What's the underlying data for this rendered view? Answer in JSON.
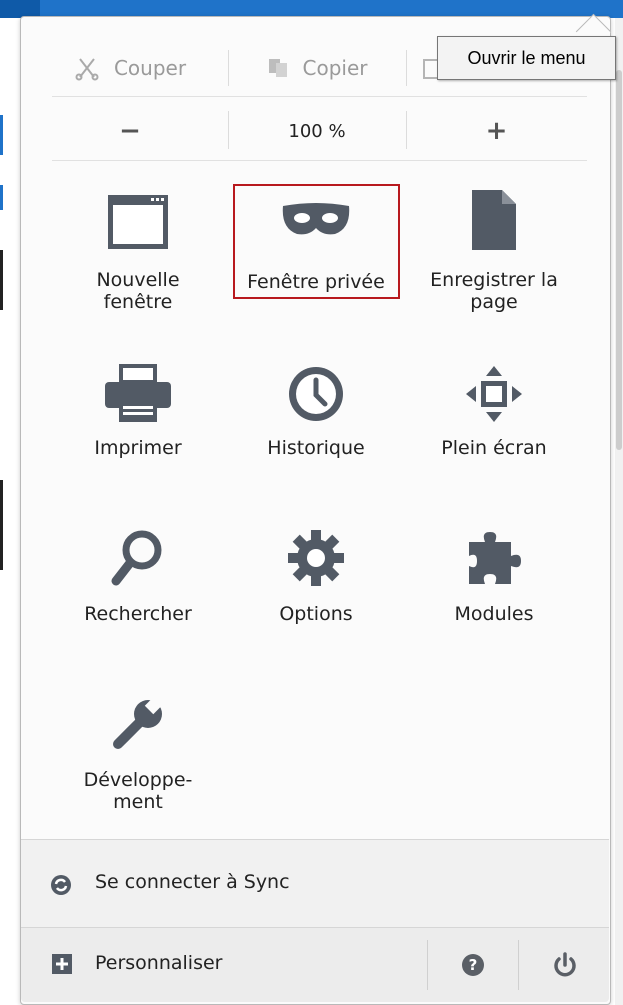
{
  "edit": {
    "cut_label": "Couper",
    "copy_label": "Copier"
  },
  "zoom": {
    "decrease_label": "−",
    "value": "100 %",
    "increase_label": "+"
  },
  "tooltip": "Ouvrir le menu",
  "grid": {
    "new_window": [
      "Nouvelle",
      "fenêtre"
    ],
    "private_window": "Fenêtre privée",
    "save_page": [
      "Enregistrer la",
      "page"
    ],
    "print": "Imprimer",
    "history": "Historique",
    "fullscreen": "Plein écran",
    "search": "Rechercher",
    "options": "Options",
    "addons": "Modules",
    "developer": [
      "Développe-",
      "ment"
    ]
  },
  "footer": {
    "sync_label": "Se connecter à Sync",
    "customize_label": "Personnaliser"
  },
  "colors": {
    "accent": "#1f73c9",
    "highlight": "#b8191e",
    "icon": "#525a65"
  }
}
